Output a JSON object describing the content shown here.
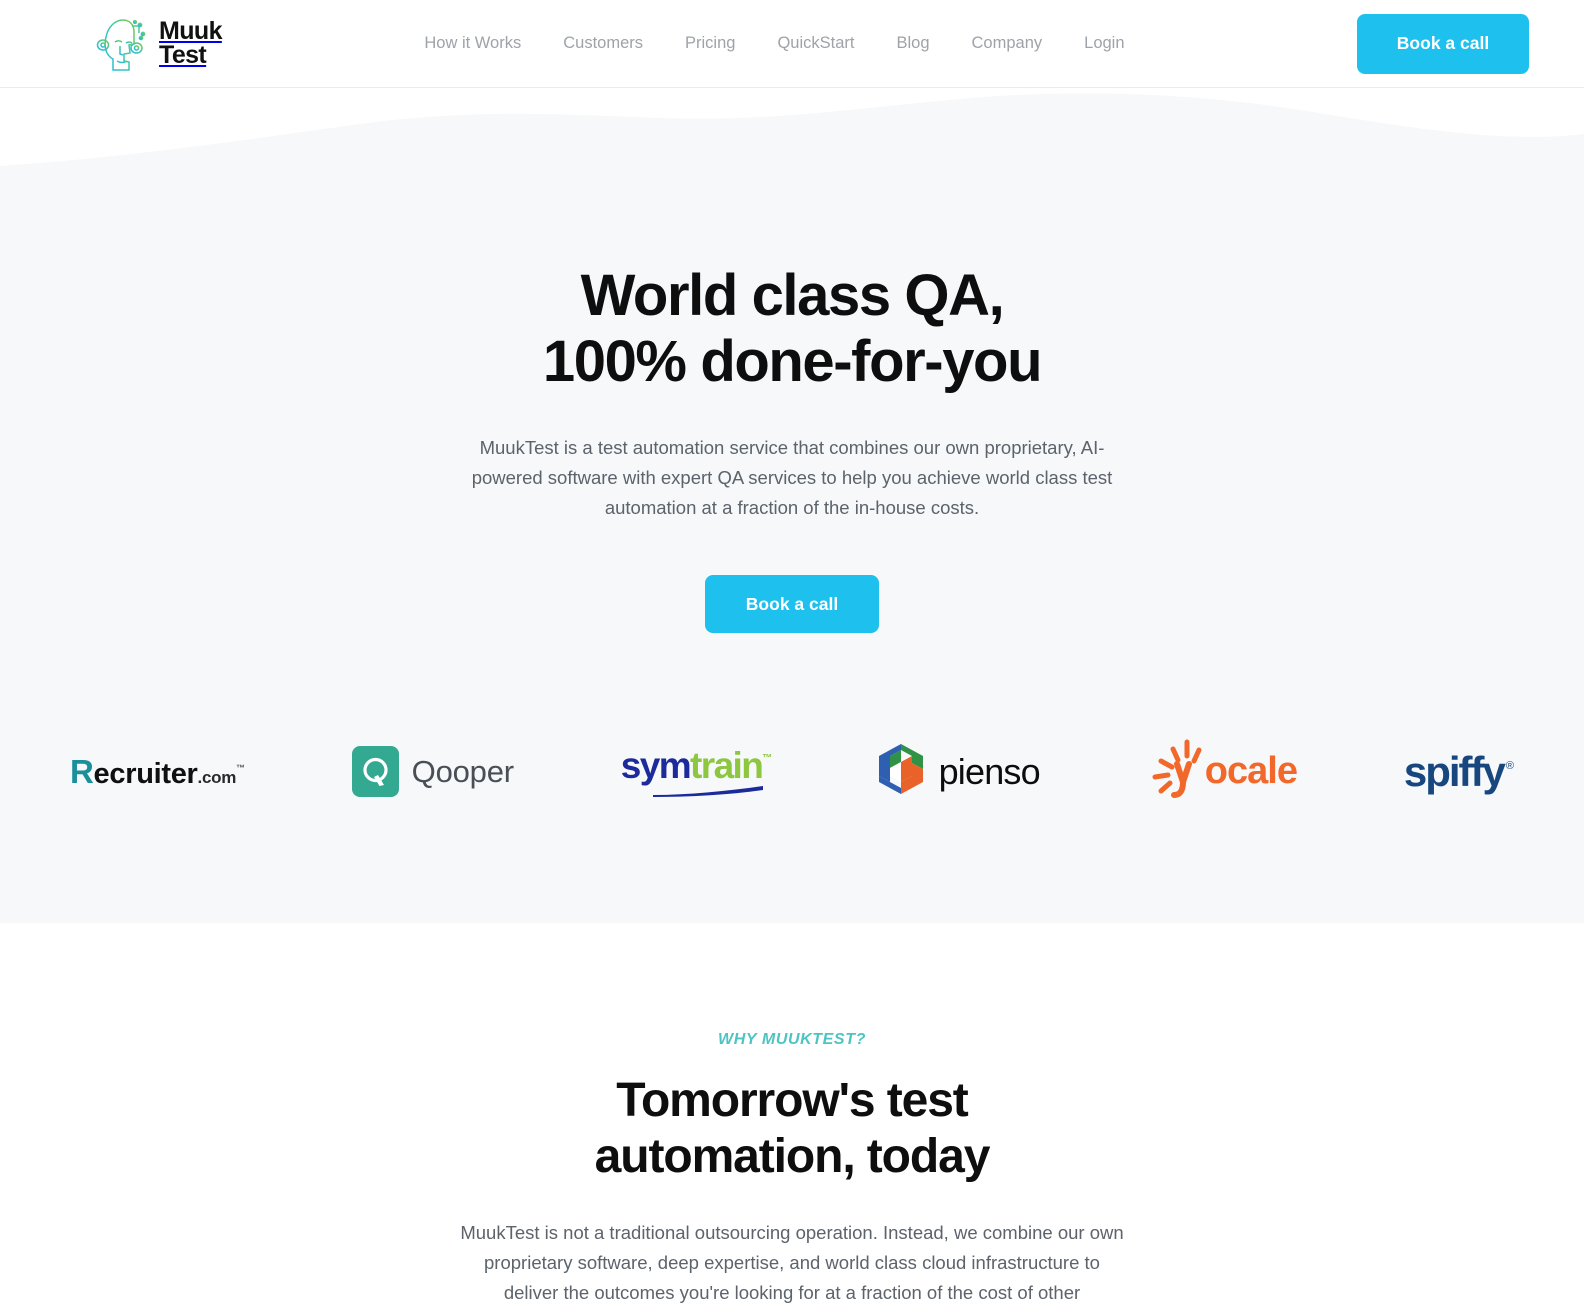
{
  "header": {
    "logo": {
      "icon": "muuktest-face-icon",
      "wordmark": "Muuk\nTest"
    },
    "nav": [
      {
        "label": "How it Works"
      },
      {
        "label": "Customers"
      },
      {
        "label": "Pricing"
      },
      {
        "label": "QuickStart"
      },
      {
        "label": "Blog"
      },
      {
        "label": "Company"
      },
      {
        "label": "Login"
      }
    ],
    "cta_label": "Book a call"
  },
  "hero": {
    "title": "World class QA,\n100% done-for-you",
    "subtitle": "MuukTest is a test automation service that combines our own proprietary, AI-powered software with expert QA services to help you achieve world class test automation at a fraction of the in-house costs.",
    "cta_label": "Book a call"
  },
  "logos": [
    {
      "name": "Recruiter.com",
      "initial": "R",
      "word": "ecruiter",
      "suffix": ".com",
      "trademark": "™"
    },
    {
      "name": "Qooper",
      "word": "Qooper",
      "mark": "Q"
    },
    {
      "name": "symtrain",
      "part1": "sym",
      "part2": "train",
      "trademark": "™"
    },
    {
      "name": "pienso",
      "word": "pienso"
    },
    {
      "name": "yocale",
      "word": "ocale",
      "initial": "y"
    },
    {
      "name": "spiffy",
      "word": "spiffy",
      "registered": "®"
    }
  ],
  "why": {
    "eyebrow": "WHY MUUKTEST?",
    "title": "Tomorrow's test\nautomation, today",
    "body": "MuukTest is not a traditional outsourcing operation. Instead, we combine our own proprietary software, deep expertise, and world class cloud infrastructure to deliver the outcomes you're looking for at a fraction of the cost of other"
  },
  "colors": {
    "accent_cyan": "#1ec0ee",
    "teal": "#4ec4c2",
    "hero_bg": "#f6f8fa",
    "text_muted": "#5c636b"
  }
}
